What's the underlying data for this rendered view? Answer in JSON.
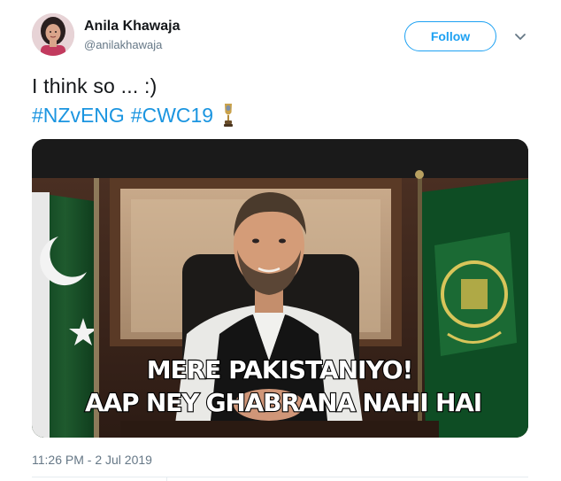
{
  "user": {
    "name": "Anila Khawaja",
    "handle": "@anilakhawaja"
  },
  "follow_label": "Follow",
  "tweet": {
    "line1": "I think so ... :)",
    "hashtag1": "#NZvENG",
    "hashtag2": "#CWC19",
    "emoji": "trophy-emoji"
  },
  "meme": {
    "line1": "MERE PAKISTANIYO!",
    "line2": "AAP NEY GHABRANA NAHI HAI"
  },
  "timestamp": "11:26 PM - 2 Jul 2019",
  "colors": {
    "brand": "#1da1f2",
    "link": "#1b95e0",
    "secondary": "#657786"
  }
}
